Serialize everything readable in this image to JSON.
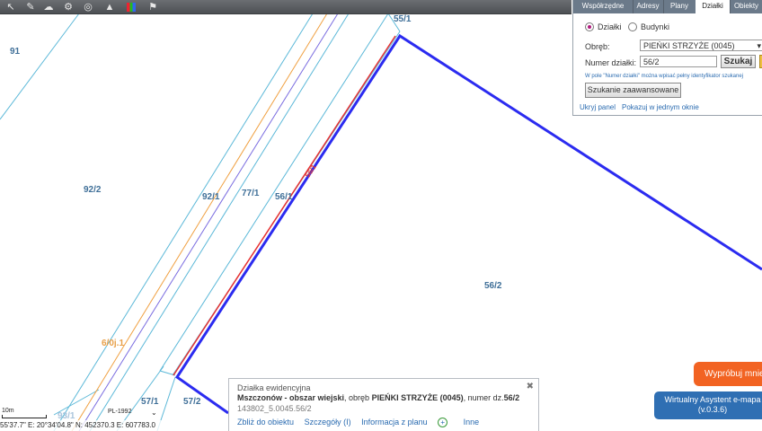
{
  "toolbar": {
    "tools": [
      "pointer-icon",
      "pen-icon",
      "globe-icon",
      "gears-icon",
      "zoom-icon",
      "measure-icon",
      "layers-icon",
      "bookmark-icon"
    ]
  },
  "panel": {
    "tabs": [
      {
        "label": "Współrzędne",
        "active": false
      },
      {
        "label": "Adresy",
        "active": false
      },
      {
        "label": "Plany",
        "active": false
      },
      {
        "label": "Działki",
        "active": true
      },
      {
        "label": "Obiekty",
        "active": false
      }
    ],
    "radio_parcels": "Działki",
    "radio_buildings": "Budynki",
    "precinct_label": "Obręb:",
    "precinct_value": "PIEŃKI STRZYŻE (0045)",
    "parcel_number_label": "Numer działki:",
    "parcel_number_value": "56/2",
    "search_button": "Szukaj",
    "hint": "W pole \"Numer działki\" można wpisać pełny identyfikator szukanej",
    "advanced_button": "Szukanie zaawansowane",
    "hide_panel": "Ukryj panel",
    "show_single_window": "Pokazuj w jednym oknie"
  },
  "map": {
    "labels": [
      {
        "text": "91",
        "style": "normal"
      },
      {
        "text": "92/2",
        "style": "normal"
      },
      {
        "text": "92/1",
        "style": "normal"
      },
      {
        "text": "77/1",
        "style": "normal"
      },
      {
        "text": "56/1",
        "style": "normal"
      },
      {
        "text": "55/1",
        "style": "normal"
      },
      {
        "text": "56/2",
        "style": "normal"
      },
      {
        "text": "57/1",
        "style": "normal"
      },
      {
        "text": "57/2",
        "style": "normal"
      },
      {
        "text": "93/1",
        "style": "faint"
      },
      {
        "text": "6/0j.1",
        "style": "orange"
      },
      {
        "text": "56/1",
        "style": "red"
      }
    ],
    "colors": {
      "selected_parcel": "#2b2bf0",
      "road_line": "#e83030",
      "parcel_line": "#5bb8d8",
      "orange_line": "#f0a040",
      "purple_line": "#7a6ce0"
    }
  },
  "popup": {
    "title": "Działka ewidencyjna",
    "municipality": "Mszczonów - obszar wiejski",
    "precinct_prefix": ", obręb ",
    "precinct": "PIEŃKI STRZYŻE (0045)",
    "number_prefix": ", numer dz.",
    "number": "56/2",
    "identifier": "143802_5.0045.56/2",
    "actions": [
      "Zbliż do obiektu",
      "Szczegóły (I)",
      "Informacja z planu",
      "Inne"
    ]
  },
  "status": {
    "scale_label": "10m",
    "crs": "PL-1992",
    "coordinates": "55'37.7\"  E: 20°34'04.8\"  N: 452370.3  E: 607783.0"
  },
  "promo": {
    "try_button": "Wypróbuj mnie",
    "assistant_title": "Wirtualny Asystent e-mapa",
    "assistant_version": "(v.0.3.6)"
  }
}
